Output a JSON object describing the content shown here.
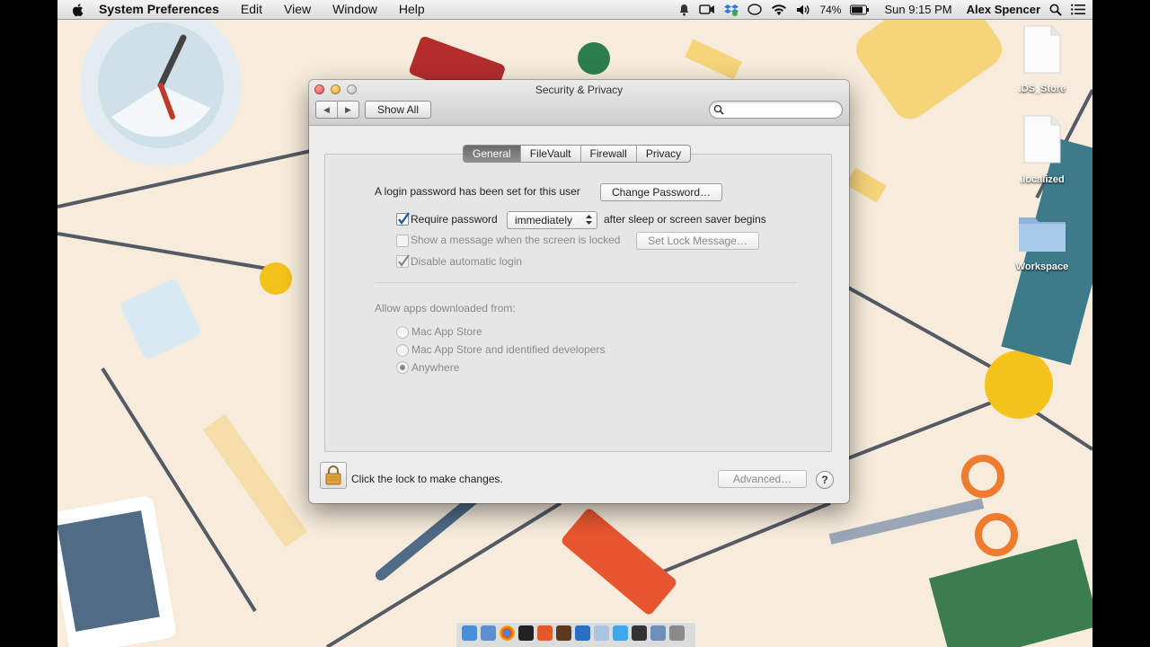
{
  "menubar": {
    "app_name": "System Preferences",
    "menus": [
      "Edit",
      "View",
      "Window",
      "Help"
    ],
    "battery": "74%",
    "clock": "Sun 9:15 PM",
    "user": "Alex Spencer"
  },
  "window": {
    "title": "Security & Privacy",
    "show_all": "Show All",
    "search_placeholder": "",
    "tabs": [
      "General",
      "FileVault",
      "Firewall",
      "Privacy"
    ],
    "selected_tab": "General",
    "general": {
      "login_password_text": "A login password has been set for this user",
      "change_password_button": "Change Password…",
      "require_password": {
        "label": "Require password",
        "checked": true
      },
      "require_password_delay": "immediately",
      "after_sleep_text": "after sleep or screen saver begins",
      "show_message": {
        "label": "Show a message when the screen is locked",
        "checked": false,
        "enabled": false
      },
      "set_lock_message_button": "Set Lock Message…",
      "disable_auto_login": {
        "label": "Disable automatic login",
        "checked": true,
        "enabled": false
      },
      "allow_apps_heading": "Allow apps downloaded from:",
      "allow_apps_options": [
        {
          "label": "Mac App Store",
          "selected": false
        },
        {
          "label": "Mac App Store and identified developers",
          "selected": false
        },
        {
          "label": "Anywhere",
          "selected": true
        }
      ]
    },
    "footer": {
      "lock_text": "Click the lock to make changes.",
      "advanced_button": "Advanced…",
      "help": "?"
    }
  },
  "desktop": {
    "icons": [
      ".DS_Store",
      ".localized",
      "Workspace"
    ]
  },
  "colors": {
    "wallpaper": "#f7ecdc",
    "selected_tab": "#7a7a7a",
    "menubar": "#e8e8e8"
  }
}
